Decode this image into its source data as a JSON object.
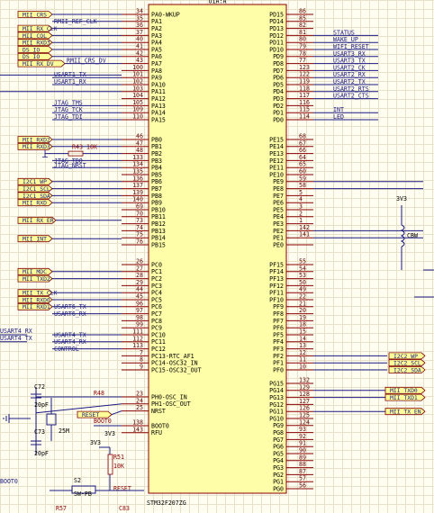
{
  "chip": {
    "ref": "U1A:A",
    "part": "STM32F207ZG"
  },
  "pins_left": [
    {
      "num": "34",
      "name": "PA0-WKUP"
    },
    {
      "num": "35",
      "name": "PA1"
    },
    {
      "num": "36",
      "name": "PA2"
    },
    {
      "num": "37",
      "name": "PA3"
    },
    {
      "num": "40",
      "name": "PA4"
    },
    {
      "num": "41",
      "name": "PA5"
    },
    {
      "num": "42",
      "name": "PA6"
    },
    {
      "num": "43",
      "name": "PA7"
    },
    {
      "num": "100",
      "name": "PA8"
    },
    {
      "num": "101",
      "name": "PA9"
    },
    {
      "num": "102",
      "name": "PA10"
    },
    {
      "num": "103",
      "name": "PA11"
    },
    {
      "num": "104",
      "name": "PA12"
    },
    {
      "num": "105",
      "name": "PA13"
    },
    {
      "num": "109",
      "name": "PA14"
    },
    {
      "num": "110",
      "name": "PA15"
    },
    {
      "num": "46",
      "name": "PB0"
    },
    {
      "num": "47",
      "name": "PB1"
    },
    {
      "num": "48",
      "name": "PB2"
    },
    {
      "num": "133",
      "name": "PB3"
    },
    {
      "num": "134",
      "name": "PB4"
    },
    {
      "num": "135",
      "name": "PB5"
    },
    {
      "num": "136",
      "name": "PB6"
    },
    {
      "num": "137",
      "name": "PB7"
    },
    {
      "num": "139",
      "name": "PB8"
    },
    {
      "num": "140",
      "name": "PB9"
    },
    {
      "num": "69",
      "name": "PB10"
    },
    {
      "num": "70",
      "name": "PB11"
    },
    {
      "num": "73",
      "name": "PB12"
    },
    {
      "num": "74",
      "name": "PB13"
    },
    {
      "num": "75",
      "name": "PB14"
    },
    {
      "num": "76",
      "name": "PB15"
    },
    {
      "num": "26",
      "name": "PC0"
    },
    {
      "num": "27",
      "name": "PC1"
    },
    {
      "num": "28",
      "name": "PC2"
    },
    {
      "num": "29",
      "name": "PC3"
    },
    {
      "num": "44",
      "name": "PC4"
    },
    {
      "num": "45",
      "name": "PC5"
    },
    {
      "num": "96",
      "name": "PC6"
    },
    {
      "num": "97",
      "name": "PC7"
    },
    {
      "num": "98",
      "name": "PC8"
    },
    {
      "num": "99",
      "name": "PC9"
    },
    {
      "num": "111",
      "name": "PC10"
    },
    {
      "num": "112",
      "name": "PC11"
    },
    {
      "num": "113",
      "name": "PC12"
    },
    {
      "num": "7",
      "name": "PC13-RTC_AF1"
    },
    {
      "num": "8",
      "name": "PC14-OSC32_IN"
    },
    {
      "num": "9",
      "name": "PC15-OSC32_OUT"
    },
    {
      "num": "23",
      "name": "PH0-OSC_IN"
    },
    {
      "num": "24",
      "name": "PH1-OSC_OUT"
    },
    {
      "num": "25",
      "name": "NRST"
    },
    {
      "num": "138",
      "name": "BOOT0"
    },
    {
      "num": "143",
      "name": "RFU"
    }
  ],
  "pins_right": [
    {
      "num": "86",
      "name": "PD15"
    },
    {
      "num": "85",
      "name": "PD14"
    },
    {
      "num": "82",
      "name": "PD13"
    },
    {
      "num": "81",
      "name": "PD12"
    },
    {
      "num": "80",
      "name": "PD11"
    },
    {
      "num": "79",
      "name": "PD10"
    },
    {
      "num": "78",
      "name": "PD9"
    },
    {
      "num": "77",
      "name": "PD8"
    },
    {
      "num": "123",
      "name": "PD7"
    },
    {
      "num": "122",
      "name": "PD6"
    },
    {
      "num": "119",
      "name": "PD5"
    },
    {
      "num": "118",
      "name": "PD4"
    },
    {
      "num": "117",
      "name": "PD3"
    },
    {
      "num": "116",
      "name": "PD2"
    },
    {
      "num": "115",
      "name": "PD1"
    },
    {
      "num": "114",
      "name": "PD0"
    },
    {
      "num": "68",
      "name": "PE15"
    },
    {
      "num": "67",
      "name": "PE14"
    },
    {
      "num": "66",
      "name": "PE13"
    },
    {
      "num": "64",
      "name": "PE12"
    },
    {
      "num": "65",
      "name": "PE11"
    },
    {
      "num": "60",
      "name": "PE10"
    },
    {
      "num": "59",
      "name": "PE9"
    },
    {
      "num": "58",
      "name": "PE8"
    },
    {
      "num": "5",
      "name": "PE7"
    },
    {
      "num": "4",
      "name": "PE6"
    },
    {
      "num": "3",
      "name": "PE5"
    },
    {
      "num": "2",
      "name": "PE4"
    },
    {
      "num": "1",
      "name": "PE3"
    },
    {
      "num": "142",
      "name": "PE2"
    },
    {
      "num": "141",
      "name": "PE1"
    },
    {
      "num": "",
      "name": "PE0"
    },
    {
      "num": "55",
      "name": "PF15"
    },
    {
      "num": "54",
      "name": "PF14"
    },
    {
      "num": "53",
      "name": "PF13"
    },
    {
      "num": "50",
      "name": "PF12"
    },
    {
      "num": "49",
      "name": "PF11"
    },
    {
      "num": "22",
      "name": "PF10"
    },
    {
      "num": "21",
      "name": "PF9"
    },
    {
      "num": "20",
      "name": "PF8"
    },
    {
      "num": "19",
      "name": "PF7"
    },
    {
      "num": "18",
      "name": "PF6"
    },
    {
      "num": "15",
      "name": "PF5"
    },
    {
      "num": "14",
      "name": "PF4"
    },
    {
      "num": "13",
      "name": "PF3"
    },
    {
      "num": "12",
      "name": "PF2"
    },
    {
      "num": "11",
      "name": "PF1"
    },
    {
      "num": "10",
      "name": "PF0"
    },
    {
      "num": "132",
      "name": "PG15"
    },
    {
      "num": "129",
      "name": "PG14"
    },
    {
      "num": "128",
      "name": "PG13"
    },
    {
      "num": "127",
      "name": "PG12"
    },
    {
      "num": "126",
      "name": "PG11"
    },
    {
      "num": "125",
      "name": "PG10"
    },
    {
      "num": "124",
      "name": "PG9"
    },
    {
      "num": "93",
      "name": "PG8"
    },
    {
      "num": "92",
      "name": "PG7"
    },
    {
      "num": "91",
      "name": "PG6"
    },
    {
      "num": "90",
      "name": "PG5"
    },
    {
      "num": "89",
      "name": "PG4"
    },
    {
      "num": "88",
      "name": "PG3"
    },
    {
      "num": "87",
      "name": "PG2"
    },
    {
      "num": "57",
      "name": "PG1"
    },
    {
      "num": "56",
      "name": "PG0"
    }
  ],
  "port_labels_left": {
    "top": [
      "MII_CRS",
      "MII_RX_CLK",
      "MII_COL",
      "MII_RXD3",
      "DS_IO",
      "DS_IO",
      "MII_RX_DV"
    ],
    "mid": [
      "MII_RXD2",
      "MII_RXD3"
    ],
    "i2c": [
      "I2C1_WP",
      "I2C1_SCL",
      "I2C1_SDA",
      "MII_RXD"
    ],
    "rxer": "MII_RX_ER",
    "int": "MII_INT",
    "pc": [
      "MII_MDC",
      "MII_TXD2",
      "MII_TX_CLK",
      "MII_RXD0",
      "MII_RXD1"
    ]
  },
  "net_labels_left": {
    "pa1": "RMII_REF_CLK",
    "pa7": "RMII_CRS_DV",
    "pa9": "USART1_TX",
    "pa10": "USART1_RX",
    "pa13": "JTAG_TMS",
    "pa14": "JTAG_TCK",
    "pa15": "JTAG_TDI",
    "pb3": "JTAG_TDO",
    "pb4": "JTAG_NRST",
    "pc6": "USART6_TX",
    "pc7": "USART6_RX",
    "pc10": "USART4_TX",
    "pc11": "USART4_RX",
    "pc12": "CONTROL",
    "far": [
      "USART4_RX",
      "USART4_TX"
    ]
  },
  "net_labels_right": {
    "pd12": "STATUS",
    "pd11": "WAKE_UP",
    "pd10": "WIFI_RESET",
    "pd9": "USART3_RX",
    "pd8": "USART3_TX",
    "pd7": "USART2_CK",
    "pd6": "USART2_RX",
    "pd5": "USART2_TX",
    "pd4": "USART2_RTS",
    "pd3": "USART2_CTS",
    "pd1": "INT",
    "pd0": "LED"
  },
  "port_labels_right": {
    "pf": [
      "I2C2_WP",
      "I2C2_SCL",
      "I2C2_SDA"
    ],
    "pg": [
      "MII_TXD0",
      "MII_TXD1",
      "MII_TX_EN"
    ]
  },
  "components": {
    "c72": {
      "ref": "C72",
      "value": "20pF"
    },
    "c73": {
      "ref": "C73",
      "value": "20pF"
    },
    "crystal": {
      "value": "25M"
    },
    "r48": "R48",
    "r43": {
      "ref": "R43",
      "value": "10K"
    },
    "r51": {
      "ref": "R51",
      "value": "10K"
    },
    "s2": {
      "ref": "S2",
      "value": "SW-PB"
    },
    "c83": "C83",
    "r57": "R57",
    "ferrite": "CBW",
    "vcc": [
      "3V3",
      "3V3",
      "3V3"
    ]
  },
  "net_labels_misc": {
    "reset": "RESET",
    "reset2": "RESET",
    "boot0": "BOOT0",
    "boot_edge": "BOOT0"
  }
}
